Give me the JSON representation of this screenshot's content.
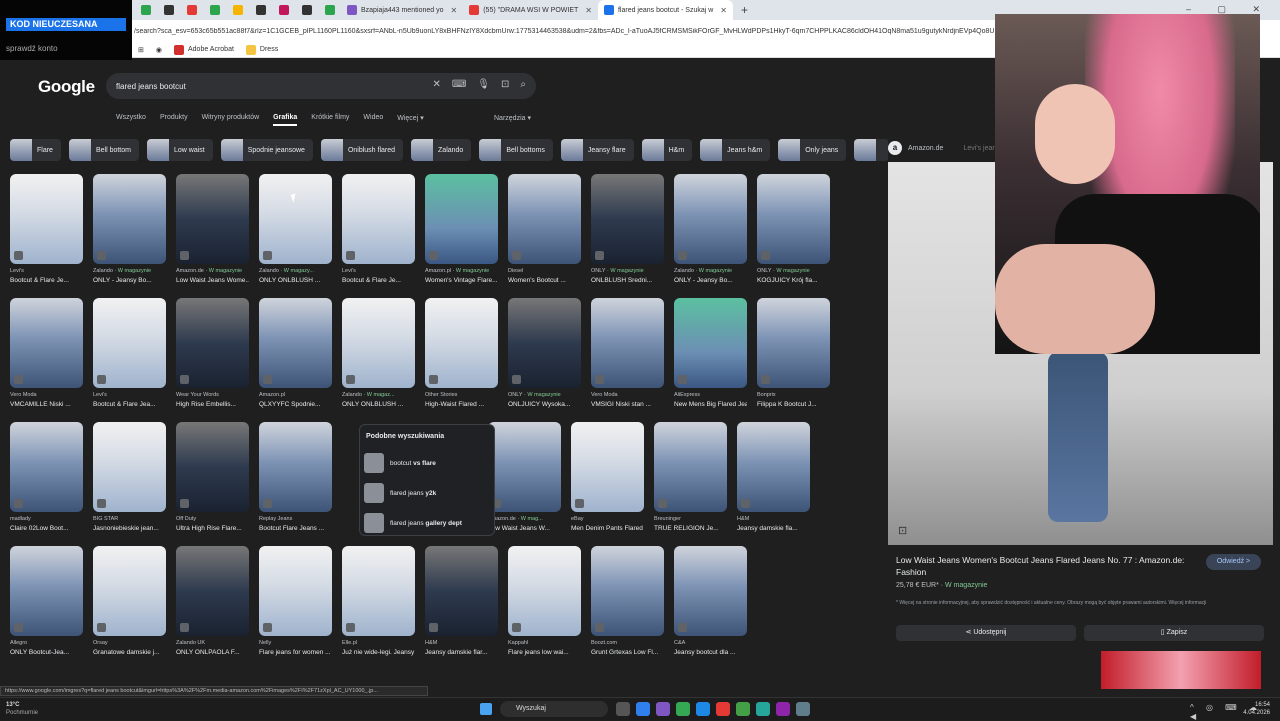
{
  "browser": {
    "tabs": [
      {
        "label": "",
        "color": "#2da44e"
      },
      {
        "label": "",
        "color": "#333333"
      },
      {
        "label": "",
        "color": "#e53935"
      },
      {
        "label": "",
        "color": "#2da44e"
      },
      {
        "label": "",
        "color": "#f4b400"
      },
      {
        "label": "",
        "color": "#333333"
      },
      {
        "label": "",
        "color": "#c2185b"
      },
      {
        "label": "",
        "color": "#333333"
      },
      {
        "label": "",
        "color": "#2da44e"
      },
      {
        "label": "Bzapiaja443 mentioned yo",
        "color": "#7e57c2"
      },
      {
        "label": "(55) \"DRAMA WSI W POWIET",
        "color": "#e53935"
      },
      {
        "label": "flared jeans bootcut - Szukaj w",
        "color": "#1a73e8"
      }
    ],
    "new_tab": "+",
    "window_controls": "– ▢ ✕",
    "url": "/search?sca_esv=653c65b551ac88f7&rlz=1C1GCEB_plPL1160PL1160&sxsrf=ANbL-n5Ub9uonLY8xBHFNzIY8XdcbmUrw:1775314463538&udm=2&fbs=ADc_l-aTuoAJ5fCRMSMSikFOrGF_MvHLWdPDPs1HkyT-6qm7CHPPLKAC86cldOH41OqN8ma51u9gutykNrdjnEVp4Qo8UrahUpa",
    "bookmarks": [
      "Adobe Acrobat",
      "Dress"
    ]
  },
  "stream_overlay": {
    "banner": "KOD NIEUCZESANA",
    "sub": "sprawdź konto"
  },
  "google": {
    "logo": "Google",
    "query": "flared jeans bootcut",
    "nav": [
      "Wszystko",
      "Produkty",
      "Witryny produktów",
      "Grafika",
      "Krótkie filmy",
      "Wideo",
      "Więcej ▾"
    ],
    "active_nav": "Grafika",
    "tools": "Narzędzia ▾",
    "chips": [
      "Flare",
      "Bell bottom",
      "Low waist",
      "Spodnie jeansowe",
      "Oniblush flared",
      "Zalando",
      "Bell bottoms",
      "Jeansy flare",
      "H&m",
      "Jeans h&m",
      "Only jeans",
      ""
    ]
  },
  "results": {
    "rows": [
      [
        {
          "source": "Levi's",
          "mag": "",
          "title": "Bootcut & Flare Je...",
          "tone": "light"
        },
        {
          "source": "Zalando · ",
          "mag": "W magazynie",
          "title": "ONLY - Jeansy Bo...",
          "tone": ""
        },
        {
          "source": "Amazon.de · ",
          "mag": "W magazynie",
          "title": "Low Waist Jeans Wome...",
          "tone": "dark"
        },
        {
          "source": "Zalando · ",
          "mag": "W magazy...",
          "title": "ONLY ONLBLUSH ...",
          "tone": "light"
        },
        {
          "source": "Levi's",
          "mag": "",
          "title": "Bootcut & Flare Je...",
          "tone": "light"
        },
        {
          "source": "Amazon.pl · ",
          "mag": "W magazynie",
          "title": "Women's Vintage Flare...",
          "tone": "green"
        },
        {
          "source": "Diesel",
          "mag": "",
          "title": "Women's Bootcut ...",
          "tone": ""
        },
        {
          "source": "ONLY · ",
          "mag": "W magazynie",
          "title": "ONLBLUSH Średni...",
          "tone": "dark"
        },
        {
          "source": "Zalando · ",
          "mag": "W magazynie",
          "title": "ONLY - Jeansy Bo...",
          "tone": ""
        },
        {
          "source": "ONLY · ",
          "mag": "W magazynie",
          "title": "KOGJUICY Krój fla...",
          "tone": ""
        }
      ],
      [
        {
          "source": "Vero Moda",
          "mag": "",
          "title": "VMCAMILLE Niski ...",
          "tone": ""
        },
        {
          "source": "Levi's",
          "mag": "",
          "title": "Bootcut & Flare Jea...",
          "tone": "light"
        },
        {
          "source": "Wear Your Words",
          "mag": "",
          "title": "High Rise Embellis...",
          "tone": "dark"
        },
        {
          "source": "Amazon.pl",
          "mag": "",
          "title": "QLXYYFC Spodnie...",
          "tone": ""
        },
        {
          "source": "Zalando · ",
          "mag": "W magaz...",
          "title": "ONLY ONLBLUSH ...",
          "tone": "light"
        },
        {
          "source": "Other Stories",
          "mag": "",
          "title": "High-Waist Flared ...",
          "tone": "light"
        },
        {
          "source": "ONLY · ",
          "mag": "W magazynie",
          "title": "ONLJUICY Wysoka...",
          "tone": "dark"
        },
        {
          "source": "Vero Moda",
          "mag": "",
          "title": "VMSIGI Niski stan ...",
          "tone": ""
        },
        {
          "source": "AliExpress",
          "mag": "",
          "title": "New Mens Big Flared Jea...",
          "tone": "green"
        },
        {
          "source": "Bonprix",
          "mag": "",
          "title": "Filippa K Bootcut J...",
          "tone": ""
        }
      ],
      [
        {
          "source": "madlady",
          "mag": "",
          "title": "Claire 02Low Boot...",
          "tone": ""
        },
        {
          "source": "BIG STAR",
          "mag": "",
          "title": "Jasnoniebieskie jean...",
          "tone": "light"
        },
        {
          "source": "Off Duty",
          "mag": "",
          "title": "Ultra High Rise Flare...",
          "tone": "dark"
        },
        {
          "source": "Replay Jeans",
          "mag": "",
          "title": "Bootcut Flare Jeans ...",
          "tone": ""
        },
        {
          "source": "Amazon.de · ",
          "mag": "W mag...",
          "title": "Low Waist Jeans W...",
          "tone": ""
        },
        {
          "source": "eBay",
          "mag": "",
          "title": "Men Denim Pants Flared B...",
          "tone": "light"
        },
        {
          "source": "Breuninger",
          "mag": "",
          "title": "TRUE RELIGION Je...",
          "tone": ""
        },
        {
          "source": "H&M",
          "mag": "",
          "title": "Jeansy damskie fla...",
          "tone": ""
        }
      ],
      [
        {
          "source": "Allegro",
          "mag": "",
          "title": "ONLY Bootcut-Jea...",
          "tone": ""
        },
        {
          "source": "Orsay",
          "mag": "",
          "title": "Granatowe damskie j...",
          "tone": "light"
        },
        {
          "source": "Zalando UK",
          "mag": "",
          "title": "ONLY ONLPAOLA F...",
          "tone": "dark"
        },
        {
          "source": "Nelly",
          "mag": "",
          "title": "Flare jeans for women ...",
          "tone": "light"
        },
        {
          "source": "Elle.pl",
          "mag": "",
          "title": "Już nie wide-legi. Jeansy bootcut to naj...",
          "tone": "light"
        },
        {
          "source": "H&M",
          "mag": "",
          "title": "Jeansy damskie flar...",
          "tone": "dark"
        },
        {
          "source": "Kappahl",
          "mag": "",
          "title": "Flare jeans low wai...",
          "tone": "light"
        },
        {
          "source": "Boozt.com",
          "mag": "",
          "title": "Grunt Grtexas Low Fl...",
          "tone": ""
        },
        {
          "source": "C&A",
          "mag": "",
          "title": "Jeansy bootcut dla ...",
          "tone": ""
        }
      ]
    ],
    "similar": {
      "heading": "Podobne wyszukiwania",
      "items": [
        {
          "a": "bootcut ",
          "b": "vs flare"
        },
        {
          "a": "flared jeans ",
          "b": "y2k"
        },
        {
          "a": "flared jeans ",
          "b": "gallery dept"
        }
      ]
    }
  },
  "preview": {
    "source": "Amazon.de",
    "source_sub": "Levi's jeans",
    "title": "Low Waist Jeans Women's Bootcut Jeans Flared Jeans No. 77 : Amazon.de: Fashion",
    "price": "25,78 € EUR* · ",
    "stock": "W magazynie",
    "note": "* Więcej na stronie informacyjnej, aby sprawdzić dostępność i aktualne ceny. Obrazy mogą być objęte prawami autorskimi. Więcej informacji",
    "visit": "Odwiedź >",
    "share": "Udostępnij",
    "save": "Zapisz"
  },
  "status_url": "https://www.google.com/imgres?q=flared jeans bootcut&imgurl=https%3A%2F%2Fm.media-amazon.com%2Fimages%2FI%2F71zXpl_AC_UY1000_.jp...",
  "taskbar": {
    "weather": "13°C",
    "weather_sub": "Pochmurnie",
    "search": "Wyszukaj",
    "tray": "^ ◎ ⌨ ☁ ◀",
    "time": "16:54",
    "date": "4.04.2026",
    "app_colors": [
      "#555555",
      "#2f80ed",
      "#7e57c2",
      "#34a853",
      "#1e88e5",
      "#e53935",
      "#43a047",
      "#26a69a",
      "#8e24aa",
      "#607d8b"
    ]
  }
}
